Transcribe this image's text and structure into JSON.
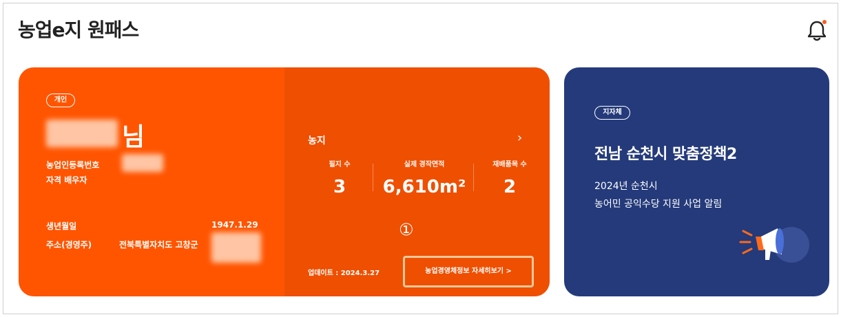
{
  "app": {
    "title": "농업e지 원패스"
  },
  "farmer": {
    "badge": "개인",
    "honorific": "님",
    "reg_label": "농업인등록번호",
    "status": "자격 배우자",
    "birth_label": "생년월일",
    "birth_value": "1947.1.29",
    "address_label": "주소(경영주)",
    "address_value": "전북특별자치도 고창군"
  },
  "farm": {
    "title": "농지",
    "stats": [
      {
        "label": "필지 수",
        "value": "3"
      },
      {
        "label": "실제 경작면적",
        "value": "6,610m²"
      },
      {
        "label": "재배품목 수",
        "value": "2"
      }
    ],
    "annotation": "①",
    "updated": "업데이트 : 2024.3.27",
    "detail_link": "농업경영체정보 자세히보기 >"
  },
  "policy": {
    "badge": "지자체",
    "title": "전남 순천시 맞춤정책2",
    "line1": "2024년 순천시",
    "line2": "농어민 공익수당 지원 사업 알림"
  },
  "colors": {
    "orange": "#ff5500",
    "orange_dark": "#ef4f00",
    "navy": "#243a7a",
    "highlight": "#f2c99a"
  },
  "icons": {
    "bell": "bell-icon",
    "chevron": "chevron-right-icon",
    "megaphone": "megaphone-icon"
  }
}
